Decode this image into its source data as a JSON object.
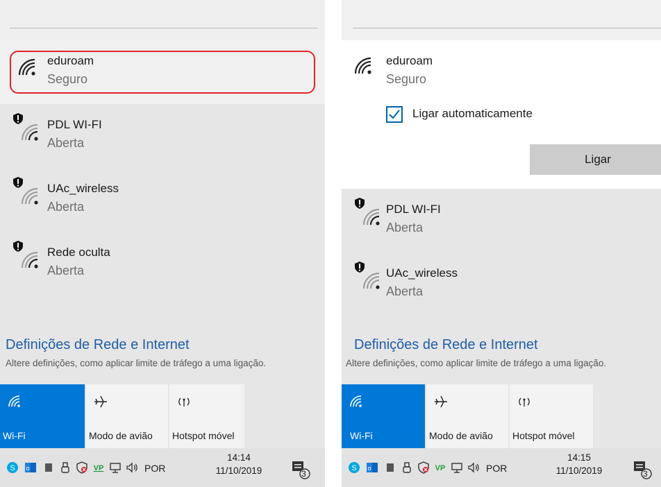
{
  "colors": {
    "accent": "#0078d7",
    "highlight": "#e0242a",
    "link": "#1f5da8"
  },
  "left": {
    "networks": [
      {
        "name": "eduroam",
        "status": "Seguro",
        "secured": true,
        "icon": "wifi-signal-icon"
      },
      {
        "name": "PDL WI-FI",
        "status": "Aberta",
        "secured": false,
        "icon": "wifi-open-icon"
      },
      {
        "name": "UAc_wireless",
        "status": "Aberta",
        "secured": false,
        "icon": "wifi-open-icon"
      },
      {
        "name": "Rede oculta",
        "status": "Aberta",
        "secured": false,
        "icon": "wifi-open-icon"
      }
    ],
    "settings_title": "Definições de Rede e Internet",
    "settings_sub": "Altere definições, como aplicar limite de tráfego a uma ligação.",
    "tiles": [
      {
        "label": "Wi-Fi",
        "icon": "wifi-icon",
        "active": true
      },
      {
        "label": "Modo de avião",
        "icon": "airplane-icon",
        "active": false
      },
      {
        "label": "Hotspot móvel",
        "icon": "hotspot-icon",
        "active": false
      }
    ],
    "taskbar": {
      "lang": "POR",
      "time": "14:14",
      "date": "11/10/2019",
      "notifications": "3"
    }
  },
  "right": {
    "expanded": {
      "name": "eduroam",
      "status": "Seguro",
      "checkbox_label": "Ligar automaticamente",
      "checked": true,
      "connect_label": "Ligar"
    },
    "networks": [
      {
        "name": "PDL WI-FI",
        "status": "Aberta"
      },
      {
        "name": "UAc_wireless",
        "status": "Aberta"
      }
    ],
    "settings_title": "Definições de Rede e Internet",
    "settings_sub": "Altere definições, como aplicar limite de tráfego a uma ligação.",
    "tiles": [
      {
        "label": "Wi-Fi",
        "icon": "wifi-icon",
        "active": true
      },
      {
        "label": "Modo de avião",
        "icon": "airplane-icon",
        "active": false
      },
      {
        "label": "Hotspot móvel",
        "icon": "hotspot-icon",
        "active": false
      }
    ],
    "taskbar": {
      "lang": "POR",
      "time": "14:15",
      "date": "11/10/2019",
      "notifications": "3"
    }
  }
}
